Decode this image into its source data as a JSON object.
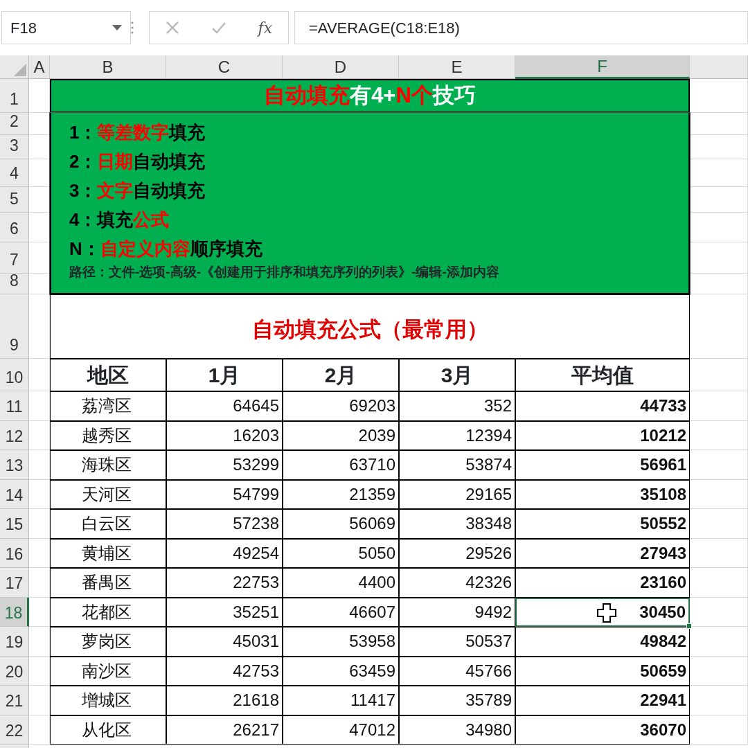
{
  "formula_bar": {
    "name_box": "F18",
    "fx": "fx",
    "formula": "=AVERAGE(C18:E18)"
  },
  "columns": [
    {
      "label": "A",
      "selected": false
    },
    {
      "label": "B",
      "selected": false
    },
    {
      "label": "C",
      "selected": false
    },
    {
      "label": "D",
      "selected": false
    },
    {
      "label": "E",
      "selected": false
    },
    {
      "label": "F",
      "selected": true
    }
  ],
  "row_numbers": [
    {
      "label": "1",
      "selected": false
    },
    {
      "label": "2",
      "selected": false
    },
    {
      "label": "3",
      "selected": false
    },
    {
      "label": "4",
      "selected": false
    },
    {
      "label": "5",
      "selected": false
    },
    {
      "label": "6",
      "selected": false
    },
    {
      "label": "7",
      "selected": false
    },
    {
      "label": "8",
      "selected": false
    },
    {
      "label": "9",
      "selected": false
    },
    {
      "label": "10",
      "selected": false
    },
    {
      "label": "11",
      "selected": false
    },
    {
      "label": "12",
      "selected": false
    },
    {
      "label": "13",
      "selected": false
    },
    {
      "label": "14",
      "selected": false
    },
    {
      "label": "15",
      "selected": false
    },
    {
      "label": "16",
      "selected": false
    },
    {
      "label": "17",
      "selected": false
    },
    {
      "label": "18",
      "selected": true
    },
    {
      "label": "19",
      "selected": false
    },
    {
      "label": "20",
      "selected": false
    },
    {
      "label": "21",
      "selected": false
    },
    {
      "label": "22",
      "selected": false
    }
  ],
  "tips_box": {
    "title": [
      {
        "text": "自动填充",
        "color": "#ff0000"
      },
      {
        "text": "有4+",
        "color": "#ffffff"
      },
      {
        "text": "N个",
        "color": "#ff0000"
      },
      {
        "text": "技巧",
        "color": "#ffffff"
      }
    ],
    "lines": [
      [
        {
          "text": "1：",
          "color": "#000000"
        },
        {
          "text": "等差数字",
          "color": "#ff0000"
        },
        {
          "text": "填充",
          "color": "#000000"
        }
      ],
      [
        {
          "text": "2：",
          "color": "#000000"
        },
        {
          "text": "日期",
          "color": "#ff0000"
        },
        {
          "text": "自动填充",
          "color": "#000000"
        }
      ],
      [
        {
          "text": "3：",
          "color": "#000000"
        },
        {
          "text": "文字",
          "color": "#ff0000"
        },
        {
          "text": "自动填充",
          "color": "#000000"
        }
      ],
      [
        {
          "text": "4：",
          "color": "#000000"
        },
        {
          "text": "填充",
          "color": "#000000"
        },
        {
          "text": "公式",
          "color": "#ff0000"
        }
      ],
      [
        {
          "text": "N：",
          "color": "#000000"
        },
        {
          "text": "自定义内容",
          "color": "#ff0000"
        },
        {
          "text": "顺序填充",
          "color": "#000000"
        }
      ]
    ],
    "path_note": "路径：文件-选项-高级-《创建用于排序和填充序列的列表》-编辑-添加内容"
  },
  "table": {
    "title": "自动填充公式（最常用）",
    "columns": [
      "地区",
      "1月",
      "2月",
      "3月",
      "平均值"
    ],
    "rows": [
      {
        "region": "荔湾区",
        "values": [
          "64645",
          "69203",
          "352"
        ],
        "average": "44733",
        "selected": false
      },
      {
        "region": "越秀区",
        "values": [
          "16203",
          "2039",
          "12394"
        ],
        "average": "10212",
        "selected": false
      },
      {
        "region": "海珠区",
        "values": [
          "53299",
          "63710",
          "53874"
        ],
        "average": "56961",
        "selected": false
      },
      {
        "region": "天河区",
        "values": [
          "54799",
          "21359",
          "29165"
        ],
        "average": "35108",
        "selected": false
      },
      {
        "region": "白云区",
        "values": [
          "57238",
          "56069",
          "38348"
        ],
        "average": "50552",
        "selected": false
      },
      {
        "region": "黄埔区",
        "values": [
          "49254",
          "5050",
          "29526"
        ],
        "average": "27943",
        "selected": false
      },
      {
        "region": "番禺区",
        "values": [
          "22753",
          "4400",
          "42326"
        ],
        "average": "23160",
        "selected": false
      },
      {
        "region": "花都区",
        "values": [
          "35251",
          "46607",
          "9492"
        ],
        "average": "30450",
        "selected": true
      },
      {
        "region": "萝岗区",
        "values": [
          "45031",
          "53958",
          "50537"
        ],
        "average": "49842",
        "selected": false
      },
      {
        "region": "南沙区",
        "values": [
          "42753",
          "63459",
          "45766"
        ],
        "average": "50659",
        "selected": false
      },
      {
        "region": "增城区",
        "values": [
          "21618",
          "11417",
          "35789"
        ],
        "average": "22941",
        "selected": false
      },
      {
        "region": "从化区",
        "values": [
          "26217",
          "47012",
          "34980"
        ],
        "average": "36070",
        "selected": false
      }
    ]
  }
}
